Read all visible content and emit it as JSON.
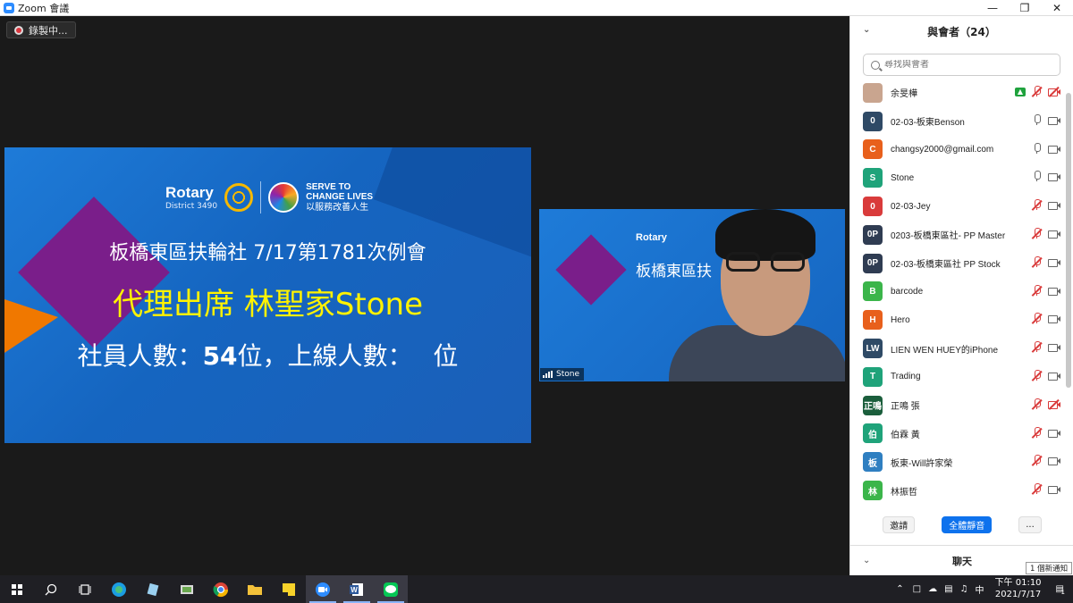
{
  "window": {
    "title": "Zoom 會議"
  },
  "recording": {
    "label": "錄製中..."
  },
  "slide": {
    "district": "District 3490",
    "serve_line1": "SERVE TO",
    "serve_line2": "CHANGE LIVES",
    "serve_line3": "以服務改善人生",
    "line1": "板橋東區扶輪社  7/17第1781次例會",
    "line2": "代理出席 林聖家Stone",
    "line3_a": "社員人數：",
    "line3_count": "54",
    "line3_b": "位，上線人數：　 位"
  },
  "video": {
    "name": "Stone",
    "bg_text": "板橋東區扶"
  },
  "participants_panel": {
    "title": "與會者（24）",
    "search_placeholder": "尋找與會者",
    "participants": [
      {
        "initials": "",
        "name": "余旻樺",
        "color": "#c9a58f",
        "mic": "off",
        "cam": "off",
        "sharing": true
      },
      {
        "initials": "0",
        "name": "02-03-板東Benson",
        "color": "#2f4a66",
        "mic": "on",
        "cam": "on",
        "sharing": false
      },
      {
        "initials": "C",
        "name": "changsy2000@gmail.com",
        "color": "#e8601c",
        "mic": "on",
        "cam": "on",
        "sharing": false
      },
      {
        "initials": "S",
        "name": "Stone",
        "color": "#1fa37a",
        "mic": "on",
        "cam": "on",
        "sharing": false
      },
      {
        "initials": "0",
        "name": "02-03-Jey",
        "color": "#d93b3b",
        "mic": "off",
        "cam": "on",
        "sharing": false
      },
      {
        "initials": "0P",
        "name": "0203-板橋東區社- PP Master",
        "color": "#2f3c52",
        "mic": "off",
        "cam": "on",
        "sharing": false
      },
      {
        "initials": "0P",
        "name": "02-03-板橋東區社 PP Stock",
        "color": "#2f3c52",
        "mic": "off",
        "cam": "on",
        "sharing": false
      },
      {
        "initials": "B",
        "name": "barcode",
        "color": "#3bb54a",
        "mic": "off",
        "cam": "on",
        "sharing": false
      },
      {
        "initials": "H",
        "name": "Hero",
        "color": "#e8601c",
        "mic": "off",
        "cam": "on",
        "sharing": false
      },
      {
        "initials": "LW",
        "name": "LIEN WEN HUEY的iPhone",
        "color": "#2f4a66",
        "mic": "off",
        "cam": "on",
        "sharing": false
      },
      {
        "initials": "T",
        "name": "Trading",
        "color": "#1fa37a",
        "mic": "off",
        "cam": "on",
        "sharing": false
      },
      {
        "initials": "正鳴",
        "name": "正鳴 張",
        "color": "#1b5e3c",
        "mic": "off",
        "cam": "off",
        "sharing": false
      },
      {
        "initials": "伯",
        "name": "伯霖 黃",
        "color": "#1fa37a",
        "mic": "off",
        "cam": "on",
        "sharing": false
      },
      {
        "initials": "板",
        "name": "板東-Will許家榮",
        "color": "#2f7fc1",
        "mic": "off",
        "cam": "on",
        "sharing": false
      },
      {
        "initials": "林",
        "name": "林振哲",
        "color": "#3bb54a",
        "mic": "off",
        "cam": "on",
        "sharing": false
      }
    ],
    "invite_label": "邀請",
    "mute_all_label": "全體靜音",
    "more_label": "...",
    "chat_label": "聊天"
  },
  "taskbar": {
    "time_line1": "下午 01:10",
    "time_line2": "2021/7/17",
    "notification": "1 個新通知",
    "ime": "中",
    "notif_count": "1"
  }
}
